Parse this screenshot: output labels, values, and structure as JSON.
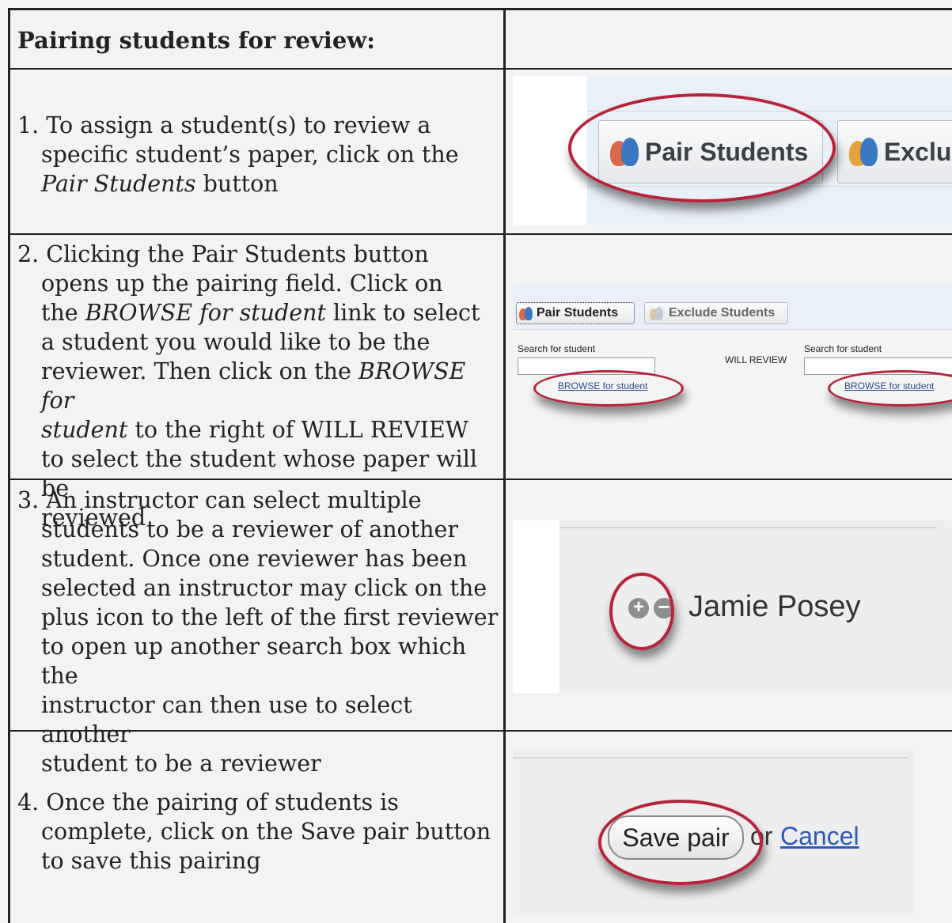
{
  "header": {
    "title": "Pairing students for review:"
  },
  "rows": [
    {
      "step": "1.",
      "line1": "To assign a student(s) to review a",
      "line2": "specific student’s paper, click on the",
      "line3_italic": "Pair Students",
      "line3_rest": " button",
      "shot": {
        "pair_label": "Pair Students",
        "exclude_label": "Exclu"
      }
    },
    {
      "step": "2.",
      "lines": [
        "Clicking the Pair Students button",
        "opens up the pairing field. Click on"
      ],
      "l3_pre": "the ",
      "l3_italic": "BROWSE for student",
      "l3_post": " link to select",
      "l4": "a student you would like to be the",
      "l5_pre": "reviewer. Then click on the ",
      "l5_italic": "BROWSE for",
      "l6_italic": "student",
      "l6_post": " to the right of WILL REVIEW",
      "l7": "to select the student whose paper will be",
      "l8": "reviewed",
      "shot": {
        "pair_label": "Pair Students",
        "exclude_label": "Exclude Students",
        "search_label_left": "Search for student",
        "search_label_right": "Search for student",
        "will_review": "WILL REVIEW",
        "browse_left": "BROWSE for student",
        "browse_right": "BROWSE for student"
      }
    },
    {
      "step": "3.",
      "lines": [
        "An instructor can select multiple",
        "students to be a reviewer of another",
        "student. Once one reviewer has been",
        "selected an instructor may click on the",
        "plus icon to the left of the first reviewer",
        "to open up another search box which the",
        "instructor can then use to select another",
        "student to be a reviewer"
      ],
      "shot": {
        "student_name": "Jamie Posey"
      }
    },
    {
      "step": "4.",
      "lines": [
        "Once the pairing of students is",
        "complete, click on the Save pair button",
        "to save this pairing"
      ],
      "shot": {
        "save_label": "Save pair",
        "or_text": "or",
        "cancel_label": "Cancel"
      }
    }
  ],
  "colors": {
    "border": "#222222",
    "highlight": "#b7233a",
    "link": "#2a4c8c"
  }
}
